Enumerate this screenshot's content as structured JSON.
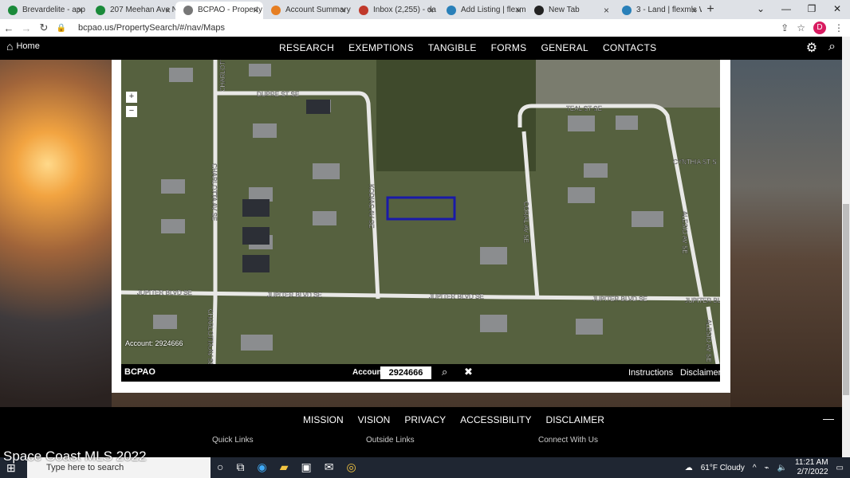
{
  "browser": {
    "tabs": [
      {
        "label": "Brevardelite - app",
        "color": "#1a8a3a",
        "active": false
      },
      {
        "label": "207 Meehan Ave N",
        "color": "#1a8a3a",
        "active": false
      },
      {
        "label": "BCPAO - Property",
        "color": "#777777",
        "active": true
      },
      {
        "label": "Account Summary",
        "color": "#e67e22",
        "active": false
      },
      {
        "label": "Inbox (2,255) - da",
        "color": "#c0392b",
        "active": false
      },
      {
        "label": "Add Listing | flexm",
        "color": "#2980b9",
        "active": false
      },
      {
        "label": "New Tab",
        "color": "#222222",
        "active": false
      },
      {
        "label": "3 - Land | flexmls W",
        "color": "#2980b9",
        "active": false
      }
    ],
    "url": "bcpao.us/PropertySearch/#/nav/Maps",
    "avatar_letter": "D"
  },
  "site": {
    "home_label": "Home",
    "menu": [
      "RESEARCH",
      "EXEMPTIONS",
      "TANGIBLE",
      "FORMS",
      "GENERAL",
      "CONTACTS"
    ]
  },
  "map": {
    "streets": {
      "dupre": "DUPRE ST SE",
      "teal": "TEAL ST SE",
      "cynthia": "CYNTHIA ST S",
      "charlotta_top": "CHARLOTTA AV SE",
      "charlotta_bottom": "CHARLOTTA AV SE",
      "kodiac": "KODIAC AV SE",
      "coral": "CORAL AV SE",
      "alesio_top": "ALESIO AV SE",
      "alesio_bottom": "ALESIO AV SE",
      "jupiter1": "JUPITER BLVD SE",
      "jupiter2": "JUPITER BLVD SE",
      "jupiter3": "JUPITER BLVD SE",
      "jupiter4": "JUPITER BLVD SE",
      "jupiter5": "JUPITER BL"
    },
    "account_overlay": "Account: 2924666",
    "bar": {
      "logo": "BCPAO",
      "account_label": "Account:",
      "account_value": "2924666",
      "instructions": "Instructions",
      "disclaimer": "Disclaimer"
    }
  },
  "footer": {
    "links": [
      "MISSION",
      "VISION",
      "PRIVACY",
      "ACCESSIBILITY",
      "DISCLAIMER"
    ],
    "quick_links": "Quick Links",
    "outside_links": "Outside Links",
    "connect": "Connect With Us"
  },
  "overlay_text": "Space Coast MLS 2022",
  "taskbar": {
    "search_placeholder": "Type here to search",
    "weather": "61°F Cloudy",
    "time": "11:21 AM",
    "date": "2/7/2022"
  }
}
